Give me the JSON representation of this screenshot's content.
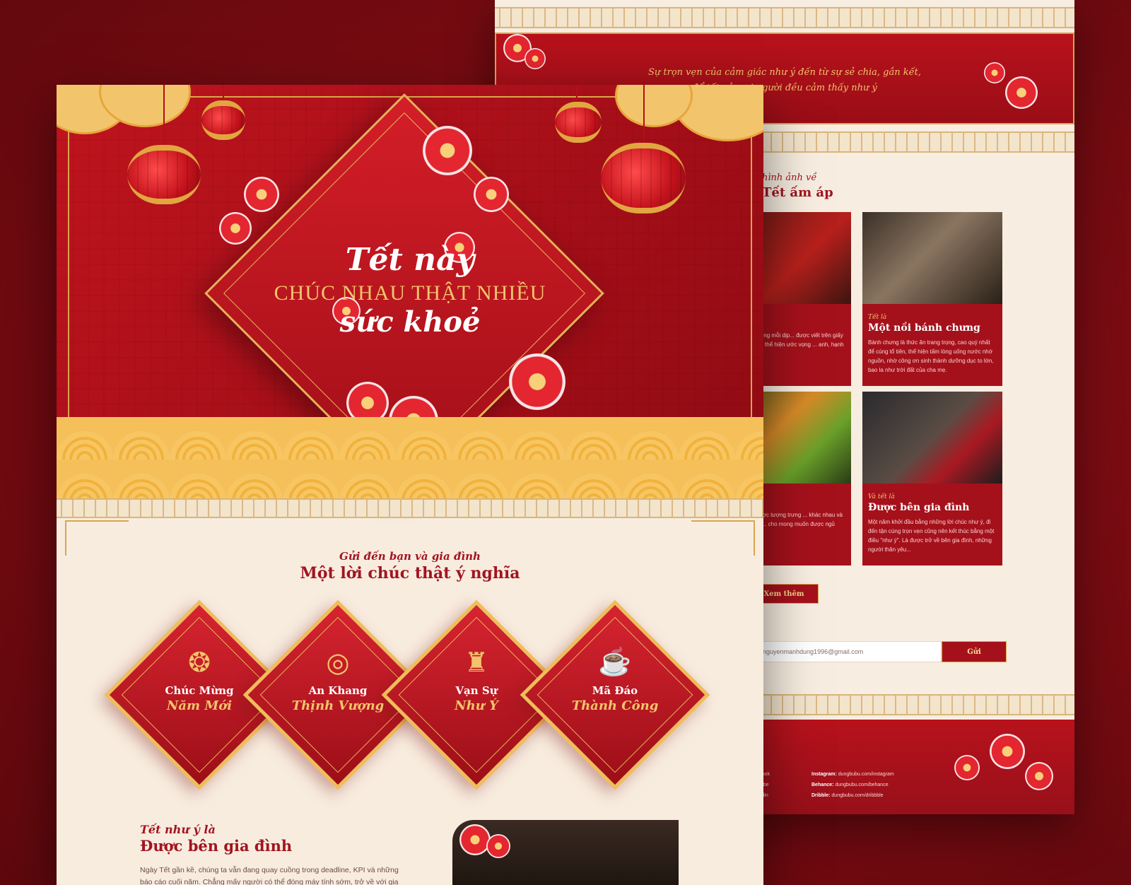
{
  "colors": {
    "background": "#7d0a12",
    "primary_red": "#a5111b",
    "gold": "#f3c46b",
    "cream": "#f8ecdf"
  },
  "back_page": {
    "quote_line1": "Sự trọn vẹn của cảm giác như ý đến từ sự sẻ chia, gắn kết,",
    "quote_line2": "để tất cả mọi người đều cảm thấy như ý",
    "gallery_kicker": "hình ảnh về",
    "gallery_title": "Tết ấm áp",
    "cards": [
      {
        "kicker": "",
        "title": "đối đỏ",
        "desc": "không thể thiếu trong mỗi dịp... được viết trên giấy hồng ... chúc tụng, thể hiện ước vọng ... anh, hạnh phúc và may mắn."
      },
      {
        "kicker": "Tết là",
        "title": "Một nồi bánh chưng",
        "desc": "Bánh chưng là thức ăn trang trọng, cao quý nhất để cúng tổ tiên, thể hiện tấm lòng uống nước nhớ nguồn, nhờ công ơn sinh thành dưỡng dục to lớn, bao la như trời đất của cha mẹ."
      },
      {
        "kicker": "",
        "title": "ũ quả",
        "desc": "...y Tết thường được tượng trưng ... khác nhau và với người Việt thì ... cho mong muốn được ngủ"
      },
      {
        "kicker": "Và tết là",
        "title": "Được bên gia đình",
        "desc": "Một năm khởi đầu bằng những lời chúc như ý, đi đến tận cùng trọn vẹn cũng nên kết thúc bằng một điều \"như ý\". Là được trở về bên gia đình, những người thân yêu..."
      }
    ],
    "more_button": "Xem thêm",
    "email_value": "nguyenmanhdung1996@gmail.com",
    "send_button": "Gửi",
    "social": [
      {
        "label": "",
        "value": "ebook"
      },
      {
        "label": "",
        "value": "utube"
      },
      {
        "label": "",
        "value": "kedin"
      },
      {
        "label": "Instagram:",
        "value": "dungbubu.com/instagram"
      },
      {
        "label": "Behance:",
        "value": "dungbubu.com/behance"
      },
      {
        "label": "Dribble:",
        "value": "dungbubu.com/dribbble"
      }
    ]
  },
  "hero": {
    "line1": "Tết này",
    "line2": "CHÚC NHAU THẬT NHIỀU",
    "line3": "sức khoẻ"
  },
  "wishes_section": {
    "kicker": "Gửi đến bạn và gia đình",
    "title": "Một lời chúc thật ý nghĩa",
    "items": [
      {
        "icon": "longevity-icon",
        "glyph": "❂",
        "line1": "Chúc Mừng",
        "line2": "Năm Mới"
      },
      {
        "icon": "coins-icon",
        "glyph": "◎",
        "line1": "An Khang",
        "line2": "Thịnh Vượng"
      },
      {
        "icon": "lantern-icon",
        "glyph": "♜",
        "line1": "Vạn Sự",
        "line2": "Như Ý"
      },
      {
        "icon": "teapot-icon",
        "glyph": "☕",
        "line1": "Mã Đáo",
        "line2": "Thành Công"
      }
    ]
  },
  "story": {
    "kicker": "Tết như ý là",
    "title": "Được bên gia đình",
    "body": "Ngày Tết gần kề, chúng ta vẫn đang quay cuồng trong deadline, KPI và những báo cáo cuối năm. Chẳng mấy người có thể đóng máy tính sớm, trở về với gia"
  }
}
